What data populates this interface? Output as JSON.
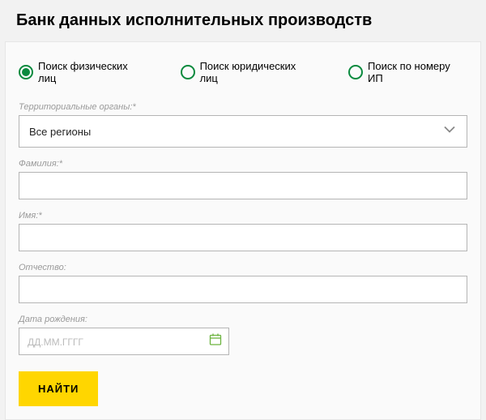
{
  "page_title": "Банк данных исполнительных производств",
  "radios": {
    "phys": "Поиск физических лиц",
    "legal": "Поиск юридических лиц",
    "ipnum": "Поиск по номеру ИП"
  },
  "labels": {
    "territory": "Территориальные органы:*",
    "lastname": "Фамилия:*",
    "firstname": "Имя:*",
    "patronymic": "Отчество:",
    "birthdate": "Дата рождения:"
  },
  "select": {
    "territory_value": "Все регионы"
  },
  "placeholders": {
    "birthdate": "ДД.ММ.ГГГГ"
  },
  "buttons": {
    "submit": "НАЙТИ"
  }
}
